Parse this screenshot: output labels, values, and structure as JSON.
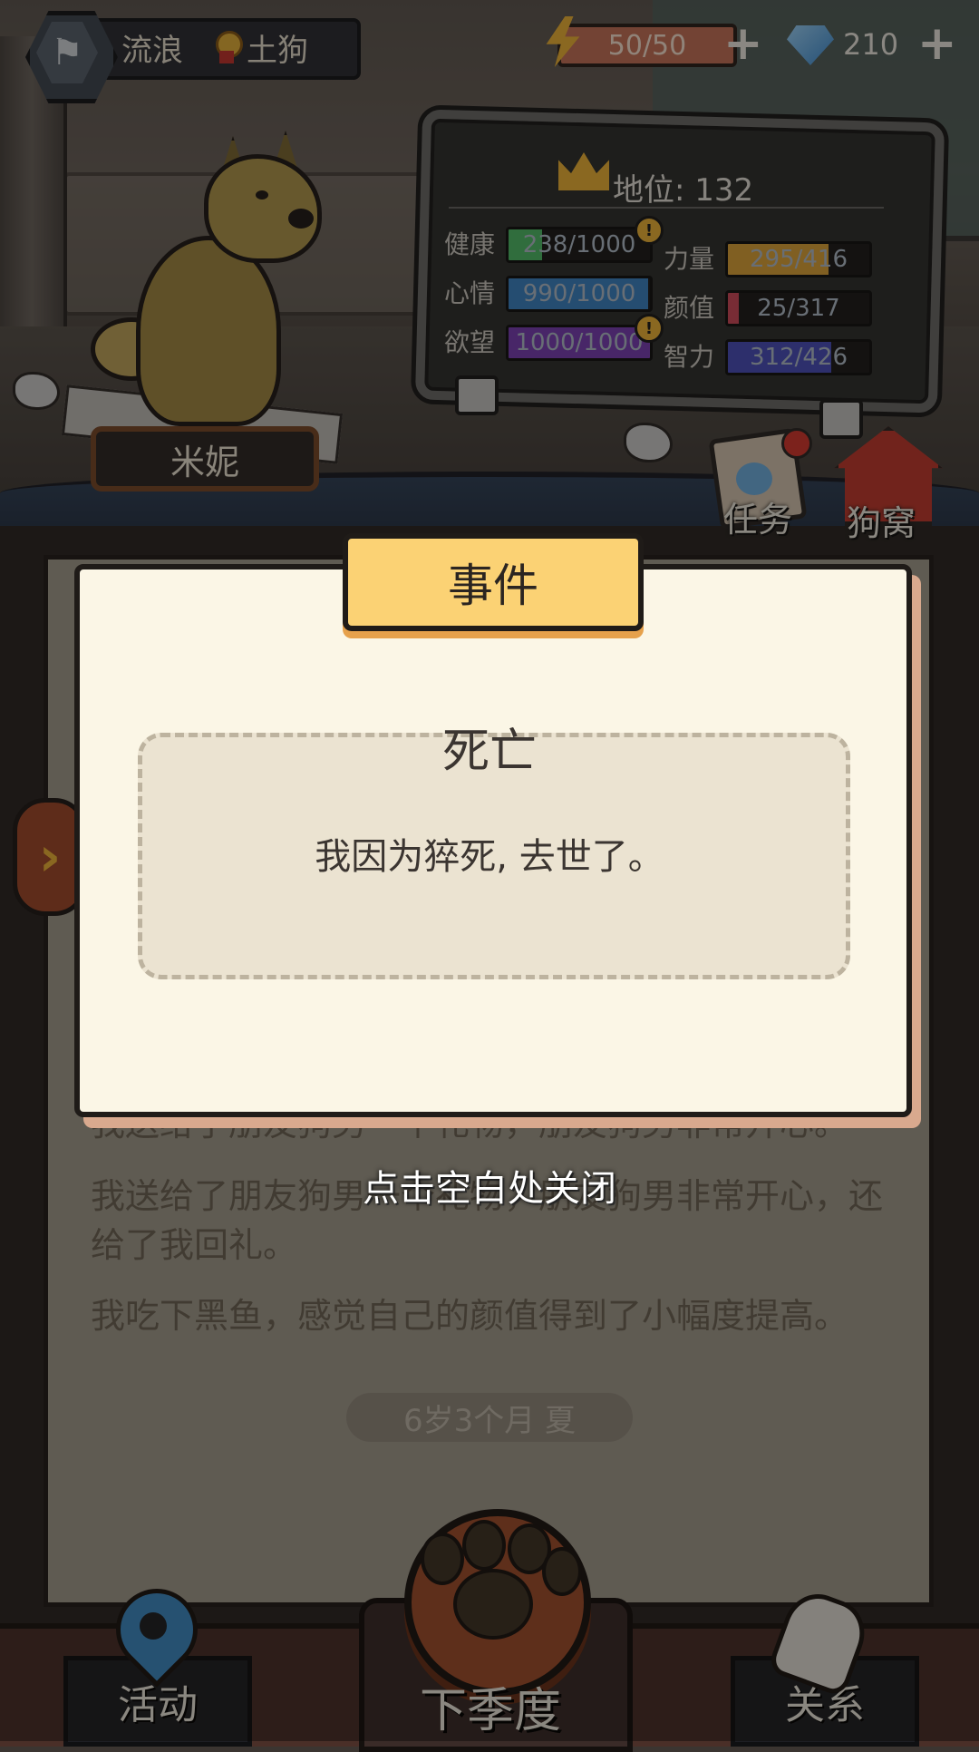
{
  "hud": {
    "status": "流浪",
    "breed": "土狗",
    "energy": "50/50",
    "gems": "210"
  },
  "pet": {
    "name": "米妮"
  },
  "stats": {
    "rank_label": "地位: 132",
    "rows": [
      {
        "label": "健康",
        "value": "238/1000",
        "fraction": 0.238,
        "color": "#4fbf6a",
        "warn": "!"
      },
      {
        "label": "心情",
        "value": "990/1000",
        "fraction": 0.99,
        "color": "#3b86c9"
      },
      {
        "label": "欲望",
        "value": "1000/1000",
        "fraction": 1.0,
        "color": "#7a3fb8",
        "warn": "!"
      }
    ],
    "rows_right": [
      {
        "label": "力量",
        "value": "295/416",
        "fraction": 0.709,
        "color": "#e0a73a"
      },
      {
        "label": "颜值",
        "value": "25/317",
        "fraction": 0.079,
        "color": "#d24a5c"
      },
      {
        "label": "智力",
        "value": "312/426",
        "fraction": 0.732,
        "color": "#4a4fbf"
      }
    ]
  },
  "side_buttons": {
    "tasks": "任务",
    "kennel": "狗窝"
  },
  "event": {
    "header": "事件",
    "title": "死亡",
    "description": "我因为猝死, 去世了。"
  },
  "log": {
    "lines": [
      "我送给了朋友狗男一个礼物，朋友狗男非常开心。",
      "我送给了朋友狗男一个礼物，朋友狗男非常开心，还给了我回礼。",
      "我吃下黑鱼，感觉自己的颜值得到了小幅度提高。"
    ],
    "age": "6岁3个月 夏"
  },
  "close_hint": "点击空白处关闭",
  "nav": {
    "activities": "活动",
    "next_season": "下季度",
    "relations": "关系"
  }
}
